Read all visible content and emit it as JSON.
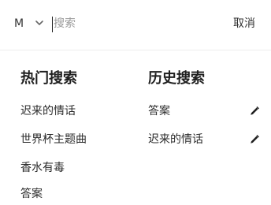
{
  "header": {
    "scope_label": "M",
    "chevron_icon": "chevron-down-icon",
    "search_placeholder": "搜索",
    "search_value": "",
    "cancel_label": "取消"
  },
  "hot": {
    "title": "热门搜索",
    "items": [
      "迟来的情话",
      "世界杯主题曲",
      "香水有毒",
      "答案"
    ]
  },
  "history": {
    "title": "历史搜索",
    "items": [
      {
        "label": "答案",
        "action_icon": "edit-pencil-icon"
      },
      {
        "label": "迟来的情话",
        "action_icon": "edit-pencil-icon"
      }
    ]
  }
}
